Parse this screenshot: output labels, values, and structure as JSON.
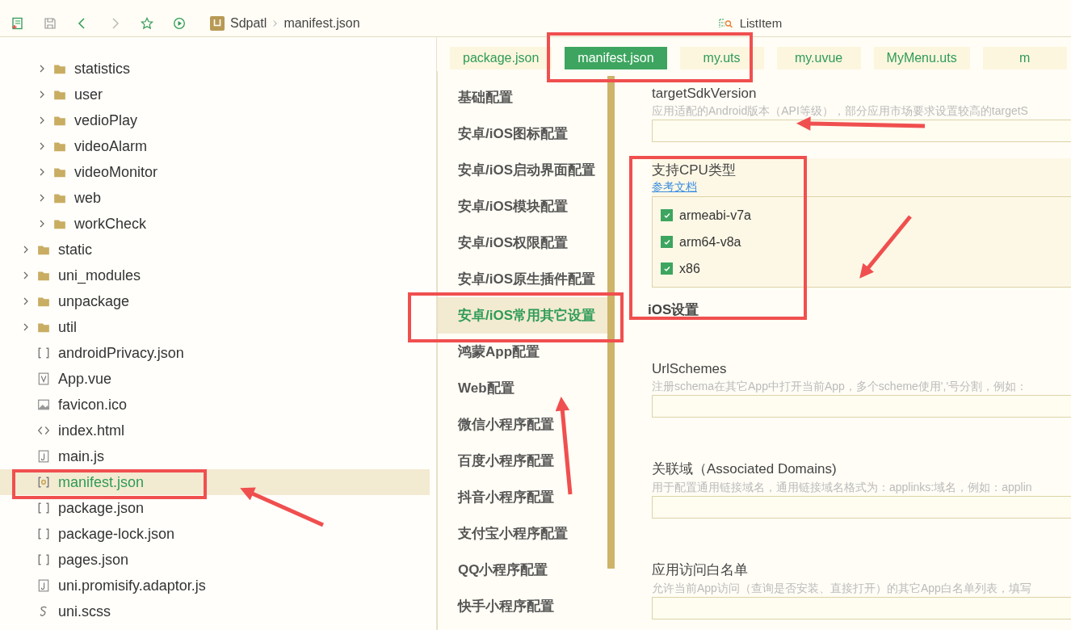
{
  "toolbar": {
    "breadcrumb": [
      "Sdpatl",
      "manifest.json"
    ],
    "outline": "ListItem"
  },
  "tree": [
    {
      "children": [
        {
          "label": "statistics",
          "kind": "folder",
          "selected": false
        },
        {
          "label": "user",
          "kind": "folder",
          "selected": false
        },
        {
          "label": "vedioPlay",
          "kind": "folder",
          "selected": false
        },
        {
          "label": "videoAlarm",
          "kind": "folder",
          "selected": false
        },
        {
          "label": "videoMonitor",
          "kind": "folder",
          "selected": false
        },
        {
          "label": "web",
          "kind": "folder",
          "selected": false
        },
        {
          "label": "workCheck",
          "kind": "folder",
          "selected": false
        }
      ]
    },
    {
      "label": "static",
      "kind": "folder",
      "selected": false
    },
    {
      "label": "uni_modules",
      "kind": "folder",
      "selected": false
    },
    {
      "label": "unpackage",
      "kind": "folder",
      "selected": false
    },
    {
      "label": "util",
      "kind": "folder",
      "selected": false
    },
    {
      "label": "androidPrivacy.json",
      "kind": "json",
      "selected": false
    },
    {
      "label": "App.vue",
      "kind": "vue",
      "selected": false
    },
    {
      "label": "favicon.ico",
      "kind": "image",
      "selected": false
    },
    {
      "label": "index.html",
      "kind": "html",
      "selected": false
    },
    {
      "label": "main.js",
      "kind": "js",
      "selected": false
    },
    {
      "label": "manifest.json",
      "kind": "manifest",
      "selected": true
    },
    {
      "label": "package.json",
      "kind": "json",
      "selected": false
    },
    {
      "label": "package-lock.json",
      "kind": "json",
      "selected": false
    },
    {
      "label": "pages.json",
      "kind": "json",
      "selected": false
    },
    {
      "label": "uni.promisify.adaptor.js",
      "kind": "js",
      "selected": false
    },
    {
      "label": "uni.scss",
      "kind": "scss",
      "selected": false
    }
  ],
  "tabs": [
    {
      "label": "package.json",
      "selected": false
    },
    {
      "label": "manifest.json",
      "selected": true
    },
    {
      "label": "my.uts",
      "selected": false
    },
    {
      "label": "my.uvue",
      "selected": false
    },
    {
      "label": "MyMenu.uts",
      "selected": false
    },
    {
      "label": "m",
      "selected": false
    }
  ],
  "nav": [
    {
      "label": "基础配置",
      "selected": false
    },
    {
      "label": "安卓/iOS图标配置",
      "selected": false
    },
    {
      "label": "安卓/iOS启动界面配置",
      "selected": false
    },
    {
      "label": "安卓/iOS模块配置",
      "selected": false
    },
    {
      "label": "安卓/iOS权限配置",
      "selected": false
    },
    {
      "label": "安卓/iOS原生插件配置",
      "selected": false
    },
    {
      "label": "安卓/iOS常用其它设置",
      "selected": true
    },
    {
      "label": "鸿蒙App配置",
      "selected": false
    },
    {
      "label": "Web配置",
      "selected": false
    },
    {
      "label": "微信小程序配置",
      "selected": false
    },
    {
      "label": "百度小程序配置",
      "selected": false
    },
    {
      "label": "抖音小程序配置",
      "selected": false
    },
    {
      "label": "支付宝小程序配置",
      "selected": false
    },
    {
      "label": "QQ小程序配置",
      "selected": false
    },
    {
      "label": "快手小程序配置",
      "selected": false
    }
  ],
  "sections": [
    {
      "kind": "field",
      "label": "targetSdkVersion",
      "description": "应用适配的Android版本（API等级），部分应用市场要求设置较高的targetS"
    },
    {
      "kind": "checklist",
      "label": "支持CPU类型",
      "link": "参考文档",
      "options": [
        {
          "label": "armeabi-v7a",
          "checked": true
        },
        {
          "label": "arm64-v8a",
          "checked": true
        },
        {
          "label": "x86",
          "checked": true
        }
      ]
    },
    {
      "kind": "heading",
      "label": "iOS设置"
    },
    {
      "kind": "field",
      "label": "UrlSchemes",
      "description": "注册schema在其它App中打开当前App，多个scheme使用','号分割，例如："
    },
    {
      "kind": "field",
      "label": "关联域（Associated Domains)",
      "description": "用于配置通用链接域名，通用链接域名格式为：applinks:域名，例如：applin"
    },
    {
      "kind": "field",
      "label": "应用访问白名单",
      "description": "允许当前App访问（查询是否安装、直接打开）的其它App白名单列表，填写"
    }
  ]
}
